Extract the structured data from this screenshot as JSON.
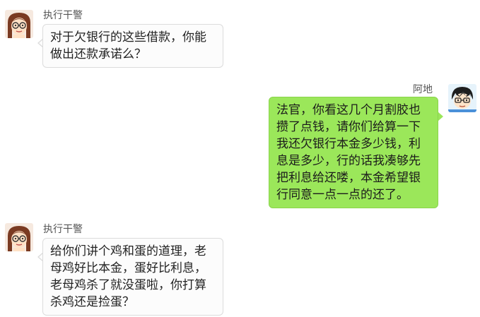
{
  "messages": [
    {
      "sender": "执行干警",
      "side": "left",
      "text": "对于欠银行的这些借款，你能做出还款承诺么？"
    },
    {
      "sender": "阿地",
      "side": "right",
      "text": "法官，你看这几个月割胶也攒了点钱，请你们给算一下我还欠银行本金多少钱，利息是多少，行的话我凑够先把利息给还喽，本金希望银行同意一点一点的还了。"
    },
    {
      "sender": "执行干警",
      "side": "left",
      "text": "给你们讲个鸡和蛋的道理，老母鸡好比本金，蛋好比利息，老母鸡杀了就没蛋啦，你打算杀鸡还是捡蛋？"
    }
  ],
  "colors": {
    "incoming_bubble": "#fcfcfc",
    "outgoing_bubble": "#9be75a"
  }
}
